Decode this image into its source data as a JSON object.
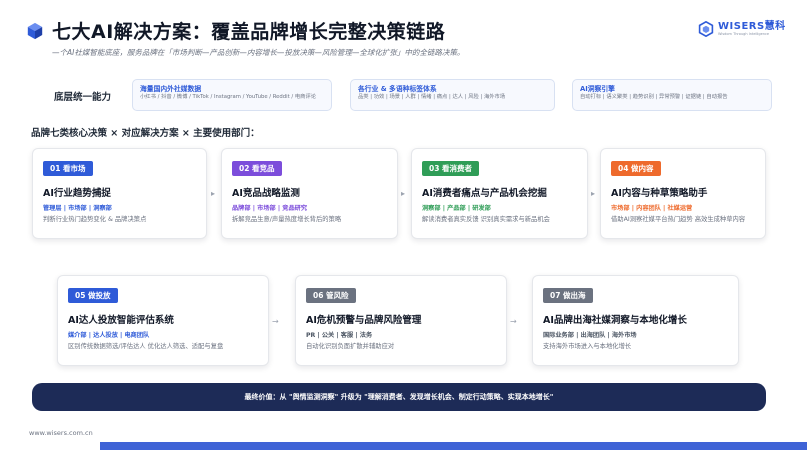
{
  "header": {
    "title": "七大AI解决方案：覆盖品牌增长完整决策链路",
    "subtitle": "—个AI社媒智能底座，服务品牌在「市场判断—产品创新—内容增长—投放决策—风险管理—全球化扩张」中的全链路决策。",
    "brand_name": "WISERS慧科",
    "brand_tagline": "Wisdom Through Intelligence",
    "accent_color": "#2f5bd8"
  },
  "foundation": {
    "label": "底层统一能力",
    "pills": [
      {
        "title": "海量国内外社媒数据",
        "desc": "小红书 / 抖音 / 微博 / TikTok / Instagram / YouTube / Reddit / 电商评论"
      },
      {
        "title": "各行业 & 多语种标签体系",
        "desc": "品类 | 功效 | 场景 | 人群 | 情绪 | 痛点 | 达人 | 风险 | 海外市场"
      },
      {
        "title": "AI洞察引擎",
        "desc": "自动打标 | 语义聚类 | 趋势识别 | 异常预警 | 证据链 | 自动报告"
      }
    ]
  },
  "section_heading": "品牌七类核心决策 × 对应解决方案 × 主要使用部门：",
  "cards": [
    {
      "badge": "01 看市场",
      "badge_color": "#2f5bd8",
      "title": "AI行业趋势捕捉",
      "depts": "管理层 | 市场部 | 洞察部",
      "depts_color": "#2f5bd8",
      "desc": "判断行业热门趋势变化 & 品牌决策点"
    },
    {
      "badge": "02 看竞品",
      "badge_color": "#7c4ddb",
      "title": "AI竞品战略监测",
      "depts": "品牌部 | 市场部 | 竞品研究",
      "depts_color": "#7c4ddb",
      "desc": "拆解竞品生意/声量热度增长背后的策略"
    },
    {
      "badge": "03 看消费者",
      "badge_color": "#2f9d57",
      "title": "AI消费者痛点与产品机会挖掘",
      "depts": "洞察部 | 产品部 | 研发部",
      "depts_color": "#2f9d57",
      "desc": "解读消费者真实反馈 识别真实需求与新品机会"
    },
    {
      "badge": "04 做内容",
      "badge_color": "#ee6a2c",
      "title": "AI内容与种草策略助手",
      "depts": "市场部 | 内容团队 | 社媒运营",
      "depts_color": "#ee6a2c",
      "desc": "借助AI洞察社媒平台热门趋势 高效生成种草内容"
    },
    {
      "badge": "05 做投放",
      "badge_color": "#2f5bd8",
      "title": "AI达人投放智能评估系统",
      "depts": "媒介部 | 达人投放 | 电商团队",
      "depts_color": "#2f5bd8",
      "desc": "区别传统数据筛选/评估达人 优化达人筛选、适配与复盘"
    },
    {
      "badge": "06 管风险",
      "badge_color": "#6b7280",
      "title": "AI危机预警与品牌风险管理",
      "depts": "PR | 公关 | 客服 | 法务",
      "depts_color": "#4b5563",
      "desc": "自动化识别负面扩散并辅助应对"
    },
    {
      "badge": "07 做出海",
      "badge_color": "#6b7280",
      "title": "AI品牌出海社媒洞察与本地化增长",
      "depts": "国际业务部 | 出海团队 | 海外市场",
      "depts_color": "#4b5563",
      "desc": "支持海外市场进入与本地化增长"
    }
  ],
  "value_bar": "最终价值：从 \"舆情监测洞察\" 升级为 \"理解消费者、发现增长机会、制定行动策略、实现本地增长\"",
  "footer": {
    "url": "www.wisers.com.cn"
  }
}
